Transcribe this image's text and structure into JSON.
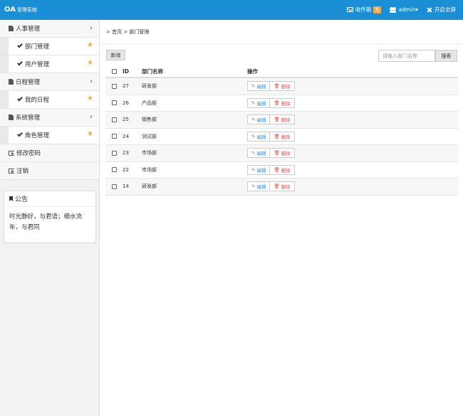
{
  "header": {
    "brand": "OA",
    "brand_sub": "管理系统",
    "inbox_label": "收件箱",
    "inbox_count": "5",
    "user_label": "admin▾",
    "fullscreen_label": "开启全屏"
  },
  "sidebar": {
    "groups": [
      {
        "label": "人事管理",
        "chevron": "›",
        "items": [
          {
            "label": "部门管理",
            "star": "★"
          },
          {
            "label": "用户管理",
            "star": "★"
          }
        ]
      },
      {
        "label": "日程管理",
        "chevron": "›",
        "items": [
          {
            "label": "我的日程",
            "star": "★"
          }
        ]
      },
      {
        "label": "系统管理",
        "chevron": "›",
        "items": [
          {
            "label": "角色管理",
            "star": "★"
          }
        ]
      }
    ],
    "links": [
      {
        "label": "修改密码"
      },
      {
        "label": "注销"
      }
    ],
    "notice": {
      "title": "公告",
      "body": "时光静好，与君语；细水流年，与君同"
    }
  },
  "main": {
    "breadcrumb": "> 首页 > 部门管理",
    "new_button": "新增",
    "search_placeholder": "请输入部门名称",
    "search_button": "搜索",
    "table": {
      "columns": [
        "ID",
        "部门名称",
        "操作"
      ],
      "edit_label": "编辑",
      "delete_label": "删除",
      "rows": [
        {
          "id": "27",
          "name": "研发部"
        },
        {
          "id": "26",
          "name": "产品部"
        },
        {
          "id": "25",
          "name": "销售部"
        },
        {
          "id": "24",
          "name": "测试部"
        },
        {
          "id": "23",
          "name": "市场部"
        },
        {
          "id": "22",
          "name": "市场部"
        },
        {
          "id": "14",
          "name": "研发部"
        }
      ]
    }
  }
}
